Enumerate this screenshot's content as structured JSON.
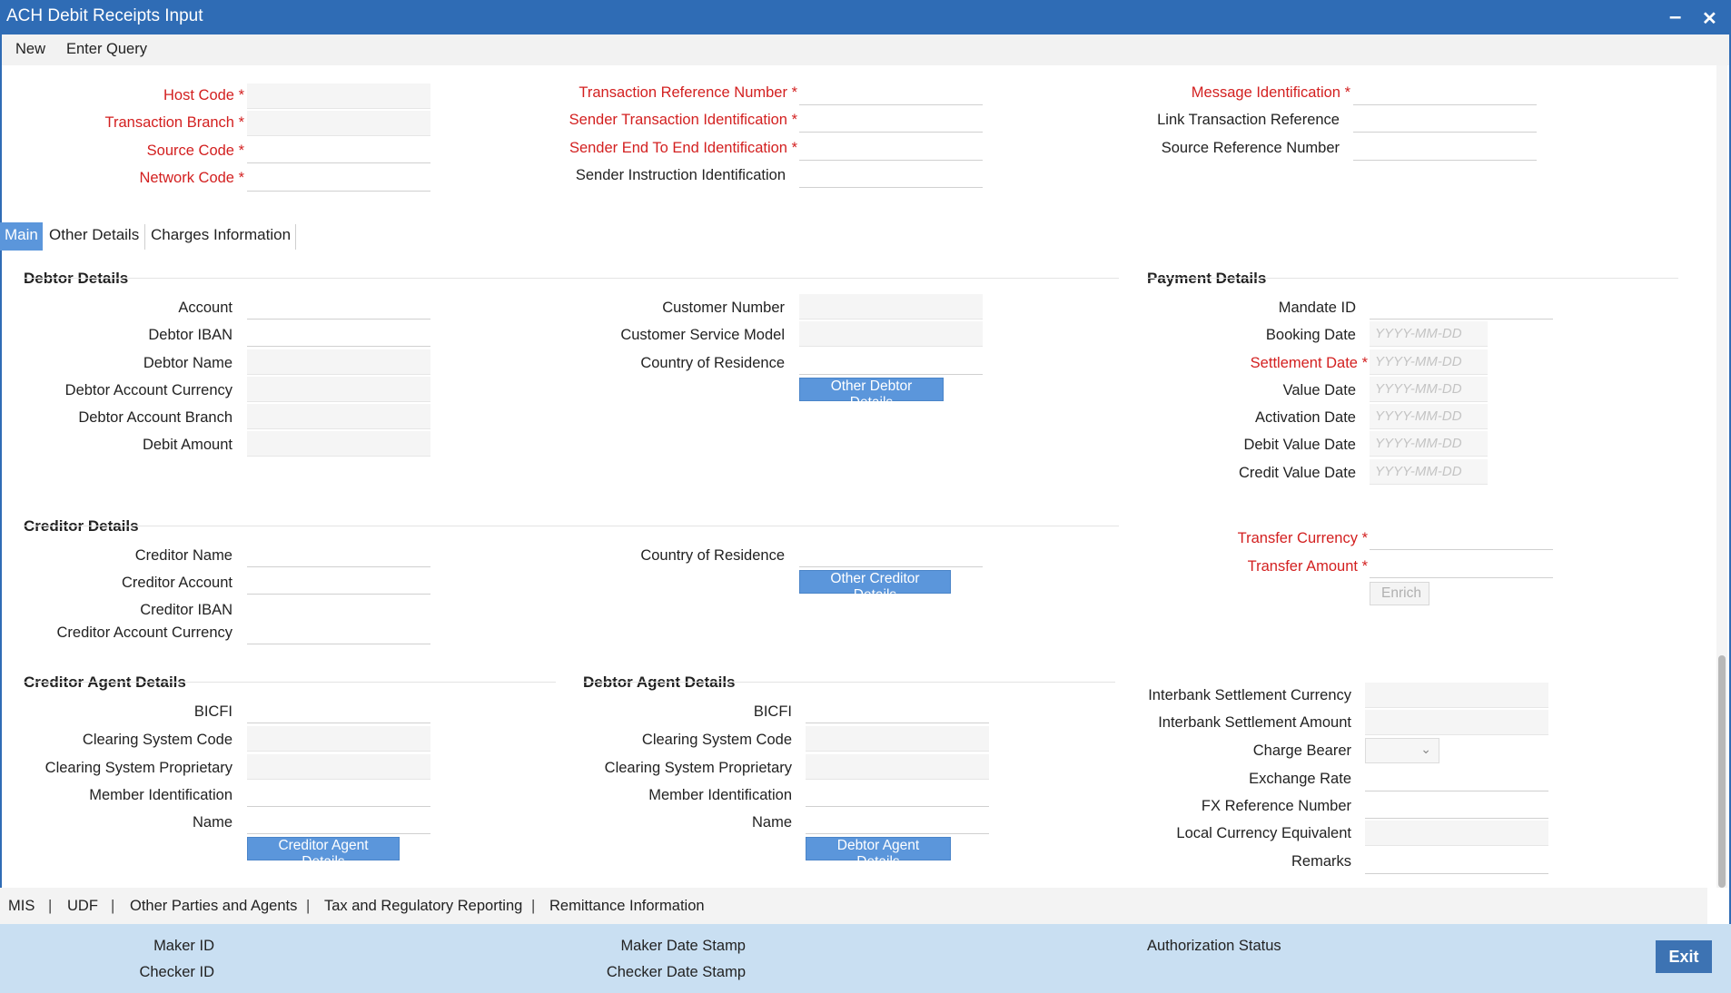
{
  "window": {
    "title": "ACH Debit Receipts Input",
    "minimize": "–",
    "close": "✕"
  },
  "menu": {
    "new": "New",
    "enter_query": "Enter Query"
  },
  "header": {
    "host_code": "Host Code",
    "transaction_branch": "Transaction Branch",
    "source_code": "Source Code",
    "network_code": "Network Code",
    "txn_ref_number": "Transaction Reference Number",
    "sender_txn_id": "Sender Transaction Identification",
    "sender_e2e_id": "Sender End To End Identification",
    "sender_instr_id": "Sender Instruction Identification",
    "message_id": "Message Identification",
    "link_txn_ref": "Link Transaction Reference",
    "source_ref_number": "Source Reference Number"
  },
  "tabs": [
    "Main",
    "Other Details",
    "Charges Information"
  ],
  "debtor": {
    "title": "Debtor Details",
    "account": "Account",
    "iban": "Debtor IBAN",
    "name": "Debtor Name",
    "currency": "Debtor Account Currency",
    "branch": "Debtor Account Branch",
    "amount": "Debit Amount",
    "customer_number": "Customer Number",
    "customer_service_model": "Customer Service Model",
    "country": "Country of Residence",
    "other_button": "Other Debtor Details"
  },
  "payment": {
    "title": "Payment Details",
    "mandate_id": "Mandate ID",
    "booking_date": "Booking Date",
    "settlement_date": "Settlement Date",
    "value_date": "Value Date",
    "activation_date": "Activation Date",
    "debit_value_date": "Debit Value Date",
    "credit_value_date": "Credit Value Date",
    "date_placeholder": "YYYY-MM-DD",
    "transfer_currency": "Transfer Currency",
    "transfer_amount": "Transfer Amount",
    "enrich_button": "Enrich"
  },
  "creditor": {
    "title": "Creditor Details",
    "name": "Creditor Name",
    "account": "Creditor Account",
    "iban": "Creditor IBAN",
    "currency": "Creditor Account Currency",
    "country": "Country of Residence",
    "other_button": "Other Creditor Details"
  },
  "creditor_agent": {
    "title": "Creditor Agent Details",
    "bicfi": "BICFI",
    "clearing_code": "Clearing System Code",
    "clearing_prop": "Clearing System Proprietary",
    "member_id": "Member Identification",
    "name": "Name",
    "button": "Creditor Agent Details"
  },
  "debtor_agent": {
    "title": "Debtor Agent Details",
    "bicfi": "BICFI",
    "clearing_code": "Clearing System Code",
    "clearing_prop": "Clearing System Proprietary",
    "member_id": "Member Identification",
    "name": "Name",
    "button": "Debtor Agent Details"
  },
  "settlement": {
    "currency": "Interbank Settlement Currency",
    "amount": "Interbank Settlement Amount",
    "charge_bearer": "Charge Bearer",
    "exchange_rate": "Exchange Rate",
    "fx_ref": "FX Reference Number",
    "lce": "Local Currency Equivalent",
    "remarks": "Remarks"
  },
  "subnav": [
    "MIS",
    "UDF",
    "Other Parties and Agents",
    "Tax and Regulatory Reporting",
    "Remittance Information"
  ],
  "subnav_sep": "|",
  "footer": {
    "maker_id": "Maker ID",
    "checker_id": "Checker ID",
    "maker_date": "Maker Date Stamp",
    "checker_date": "Checker Date Stamp",
    "auth_status": "Authorization Status",
    "exit": "Exit"
  },
  "colors": {
    "titlebar": "#2f6cb5",
    "required": "#d32020",
    "button": "#5b96db",
    "footer": "#c9dff2"
  }
}
